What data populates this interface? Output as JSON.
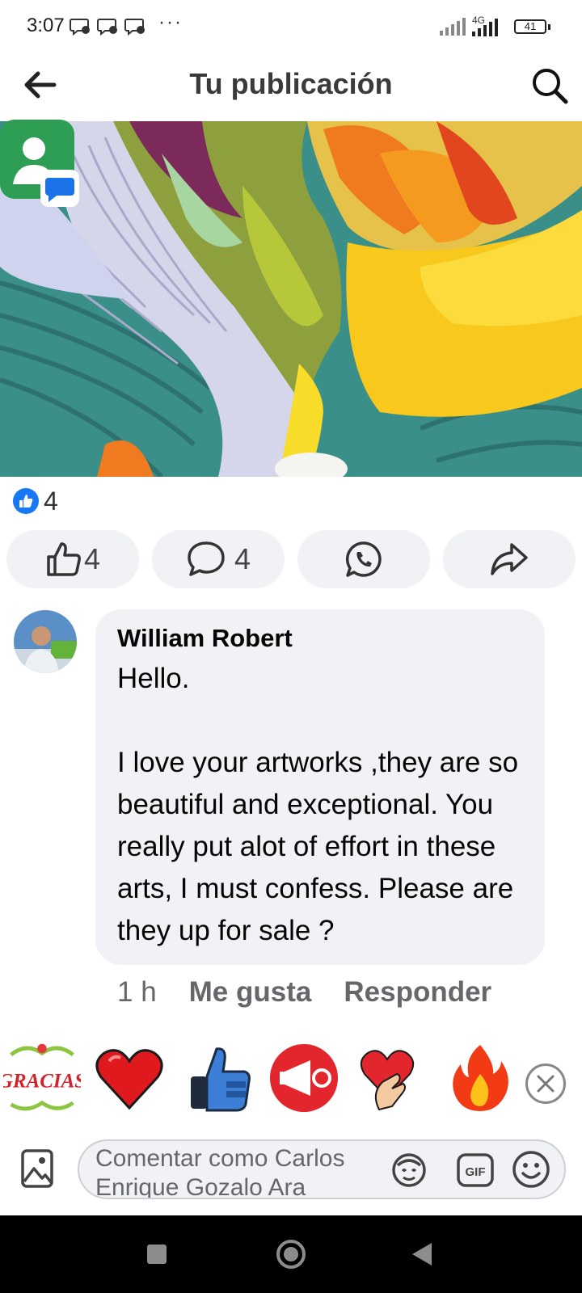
{
  "status_bar": {
    "time": "3:07",
    "dots": "···",
    "network_label": "4G",
    "battery": "41",
    "notification_icons": [
      "chat-notification-icon",
      "chat-notification-icon",
      "chat-notification-icon"
    ]
  },
  "header": {
    "title": "Tu publicación",
    "back_icon": "arrow-left-icon",
    "search_icon": "search-icon"
  },
  "post": {
    "image_description_icon": "artwork-image",
    "reactions": {
      "icon": "like-reaction-icon",
      "count": "4"
    },
    "actions": [
      {
        "name": "like",
        "icon": "thumbs-up-icon",
        "count": "4"
      },
      {
        "name": "comment",
        "icon": "comment-bubble-icon",
        "count": "4"
      },
      {
        "name": "whatsapp",
        "icon": "whatsapp-icon",
        "count": ""
      },
      {
        "name": "share",
        "icon": "share-arrow-icon",
        "count": ""
      }
    ]
  },
  "comment": {
    "author": "William Robert",
    "text": "Hello.\n\nI love your artworks ,they are so beautiful and exceptional. You really put alot of effort in these arts, I must confess. Please are they up for sale ?",
    "time": "1 h",
    "like_label": "Me gusta",
    "reply_label": "Responder"
  },
  "stickers": {
    "first_sticker_text": "GRACIAS",
    "items": [
      "gracias-sticker",
      "heart-sticker",
      "robot-thumbs-up-sticker",
      "megaphone-sticker",
      "heart-hand-sticker",
      "fire-sticker"
    ],
    "close_icon": "close-icon"
  },
  "composer": {
    "placeholder": "Comentar como Carlos Enrique Gozalo Ara",
    "gif_label": "GIF"
  },
  "colors": {
    "facebook_blue": "#1877f2",
    "bubble_gray": "#f0f2f5",
    "secondary_text": "#65676b"
  }
}
